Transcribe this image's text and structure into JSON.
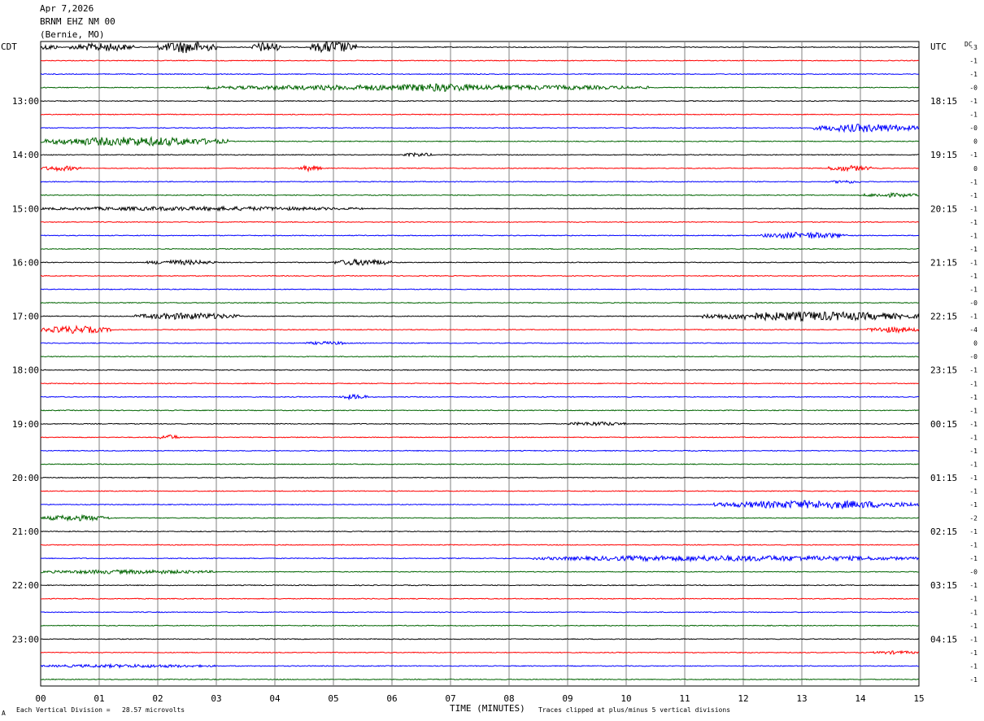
{
  "header": {
    "date": "Apr 7,2026",
    "station": "BRNM EHZ NM 00",
    "location": "(Bernie, MO)"
  },
  "left_tz": "CDT",
  "right_tz": "UTC",
  "dc_label": "DC",
  "footer": {
    "scale_note": "Each Vertical Division =   28.57 microvolts",
    "clip_note": "Traces clipped at plus/minus 5 vertical divisions",
    "corner_mark": "A"
  },
  "chart_data": {
    "type": "line",
    "title": "",
    "xlabel": "TIME (MINUTES)",
    "xlim": [
      0,
      15
    ],
    "x_ticks": [
      "00",
      "01",
      "02",
      "03",
      "04",
      "05",
      "06",
      "07",
      "08",
      "09",
      "10",
      "11",
      "12",
      "13",
      "14",
      "15"
    ],
    "trace_colors": [
      "#000000",
      "#ff0000",
      "#0000ff",
      "#006400"
    ],
    "traces_per_hour": 4,
    "left_hour_labels": [
      "13:00",
      "14:00",
      "15:00",
      "16:00",
      "17:00",
      "18:00",
      "19:00",
      "20:00",
      "21:00",
      "22:00",
      "23:00"
    ],
    "right_hour_labels": [
      "18:15",
      "19:15",
      "20:15",
      "21:15",
      "22:15",
      "23:15",
      "00:15",
      "01:15",
      "02:15",
      "03:15",
      "04:15"
    ],
    "dc_offsets": [
      "-3",
      "-1",
      "-1",
      "-0",
      "-1",
      "-1",
      "-0",
      "0",
      "-1",
      "0",
      "-1",
      "-1",
      "-1",
      "-1",
      "-1",
      "-1",
      "-1",
      "-1",
      "-1",
      "-0",
      "-1",
      "-4",
      "0",
      "-0",
      "-1",
      "-1",
      "-1",
      "-1",
      "-1",
      "-1",
      "-1",
      "-1",
      "-1",
      "-1",
      "-1",
      "-2",
      "-1",
      "-1",
      "-1",
      "-0",
      "-1",
      "-1",
      "-1",
      "-1",
      "-1",
      "-1",
      "-1",
      "-1"
    ],
    "events": [
      {
        "trace": 0,
        "start": 0.0,
        "end": 0.3,
        "amp": 6
      },
      {
        "trace": 0,
        "start": 0.5,
        "end": 1.6,
        "amp": 9
      },
      {
        "trace": 0,
        "start": 2.0,
        "end": 3.0,
        "amp": 14
      },
      {
        "trace": 0,
        "start": 3.6,
        "end": 4.1,
        "amp": 12
      },
      {
        "trace": 0,
        "start": 4.6,
        "end": 5.4,
        "amp": 14
      },
      {
        "trace": 3,
        "start": 2.8,
        "end": 10.4,
        "amp": 6
      },
      {
        "trace": 3,
        "start": 5.8,
        "end": 7.8,
        "amp": 9
      },
      {
        "trace": 6,
        "start": 13.2,
        "end": 15.0,
        "amp": 9
      },
      {
        "trace": 7,
        "start": 0.0,
        "end": 3.2,
        "amp": 10
      },
      {
        "trace": 8,
        "start": 6.2,
        "end": 6.7,
        "amp": 4
      },
      {
        "trace": 9,
        "start": 0.0,
        "end": 0.7,
        "amp": 5
      },
      {
        "trace": 9,
        "start": 4.4,
        "end": 4.8,
        "amp": 6
      },
      {
        "trace": 9,
        "start": 13.4,
        "end": 14.2,
        "amp": 6
      },
      {
        "trace": 10,
        "start": 13.5,
        "end": 14.0,
        "amp": 3
      },
      {
        "trace": 11,
        "start": 14.0,
        "end": 15.0,
        "amp": 4
      },
      {
        "trace": 12,
        "start": 0.0,
        "end": 5.5,
        "amp": 4
      },
      {
        "trace": 14,
        "start": 12.3,
        "end": 13.8,
        "amp": 7
      },
      {
        "trace": 16,
        "start": 1.8,
        "end": 3.0,
        "amp": 5
      },
      {
        "trace": 16,
        "start": 5.0,
        "end": 6.0,
        "amp": 7
      },
      {
        "trace": 20,
        "start": 1.6,
        "end": 3.4,
        "amp": 7
      },
      {
        "trace": 20,
        "start": 11.3,
        "end": 15.0,
        "amp": 10
      },
      {
        "trace": 21,
        "start": 0.0,
        "end": 1.2,
        "amp": 8
      },
      {
        "trace": 21,
        "start": 14.1,
        "end": 15.0,
        "amp": 6
      },
      {
        "trace": 22,
        "start": 4.5,
        "end": 5.3,
        "amp": 3
      },
      {
        "trace": 26,
        "start": 5.1,
        "end": 5.6,
        "amp": 5
      },
      {
        "trace": 28,
        "start": 9.0,
        "end": 10.0,
        "amp": 4
      },
      {
        "trace": 29,
        "start": 2.0,
        "end": 2.4,
        "amp": 5
      },
      {
        "trace": 34,
        "start": 11.5,
        "end": 15.0,
        "amp": 9
      },
      {
        "trace": 35,
        "start": 0.0,
        "end": 1.2,
        "amp": 6
      },
      {
        "trace": 38,
        "start": 8.4,
        "end": 15.0,
        "amp": 6
      },
      {
        "trace": 39,
        "start": 0.0,
        "end": 3.0,
        "amp": 4
      },
      {
        "trace": 45,
        "start": 14.2,
        "end": 15.0,
        "amp": 3
      },
      {
        "trace": 46,
        "start": 0.0,
        "end": 3.0,
        "amp": 3
      }
    ]
  }
}
